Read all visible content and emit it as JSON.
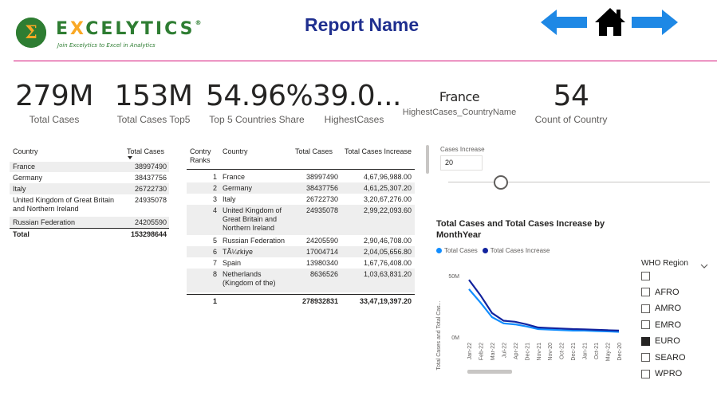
{
  "header": {
    "logo_pre": "E",
    "logo_x": "X",
    "logo_post": "CELYTICS",
    "logo_registered": "®",
    "logo_tagline": "Join Excelytics to Excel in Analytics",
    "report_name": "Report Name"
  },
  "kpis": [
    {
      "value": "279M",
      "label": "Total Cases"
    },
    {
      "value": "153M",
      "label": "Total Cases Top5"
    },
    {
      "value": "54.96%",
      "label": "Top 5 Countries Share"
    },
    {
      "value": "39.0...",
      "label": "HighestCases"
    },
    {
      "value": "France",
      "label": "HighestCases_CountryName"
    },
    {
      "value": "54",
      "label": "Count of Country"
    }
  ],
  "table_top5": {
    "headers": [
      "Country",
      "Total Cases"
    ],
    "rows": [
      {
        "country": "France",
        "cases": "38997490"
      },
      {
        "country": "Germany",
        "cases": "38437756"
      },
      {
        "country": "Italy",
        "cases": "26722730"
      },
      {
        "country": "United Kingdom of Great Britain and Northern Ireland",
        "cases": "24935078"
      },
      {
        "country": "Russian Federation",
        "cases": "24205590"
      }
    ],
    "total_label": "Total",
    "total_value": "153298644"
  },
  "table_ranks": {
    "headers": [
      "Contry Ranks",
      "Country",
      "Total Cases",
      "Total Cases Increase"
    ],
    "rows": [
      {
        "rank": "1",
        "country": "France",
        "cases": "38997490",
        "increase": "4,67,96,988.00"
      },
      {
        "rank": "2",
        "country": "Germany",
        "cases": "38437756",
        "increase": "4,61,25,307.20"
      },
      {
        "rank": "3",
        "country": "Italy",
        "cases": "26722730",
        "increase": "3,20,67,276.00"
      },
      {
        "rank": "4",
        "country": "United Kingdom of Great Britain and Northern Ireland",
        "cases": "24935078",
        "increase": "2,99,22,093.60"
      },
      {
        "rank": "5",
        "country": "Russian Federation",
        "cases": "24205590",
        "increase": "2,90,46,708.00"
      },
      {
        "rank": "6",
        "country": "TÃ¼rkiye",
        "cases": "17004714",
        "increase": "2,04,05,656.80"
      },
      {
        "rank": "7",
        "country": "Spain",
        "cases": "13980340",
        "increase": "1,67,76,408.00"
      },
      {
        "rank": "8",
        "country": "Netherlands (Kingdom of the)",
        "cases": "8636526",
        "increase": "1,03,63,831.20"
      }
    ],
    "total_rank": "1",
    "total_cases": "278932831",
    "total_increase": "33,47,19,397.20"
  },
  "slicer": {
    "title": "Cases Increase",
    "value": "20"
  },
  "chart": {
    "title": "Total Cases and Total Cases Increase by MonthYear",
    "legend": [
      "Total Cases",
      "Total Cases Increase"
    ],
    "colors": {
      "total_cases": "#118dff",
      "total_cases_increase": "#12239e"
    },
    "y_axis_label": "Total Cases and Total Cas...",
    "y_ticks": [
      "50M",
      "0M"
    ]
  },
  "chart_data": {
    "type": "line",
    "title": "Total Cases and Total Cases Increase by MonthYear",
    "x": [
      "Jan-22",
      "Feb-22",
      "Mar-22",
      "Jul-22",
      "Apr-22",
      "Dec-21",
      "Nov-21",
      "Nov-20",
      "Oct-22",
      "Dec-21",
      "Jan-21",
      "Oct-21",
      "May-22",
      "Dec-20"
    ],
    "ylabel": "Total Cases and Total Cas...",
    "ylim": [
      0,
      60000000
    ],
    "series": [
      {
        "name": "Total Cases",
        "values": [
          47000000,
          34000000,
          20000000,
          14000000,
          13000000,
          11000000,
          8500000,
          8000000,
          7500000,
          7000000,
          7000000,
          6500000,
          6200000,
          5800000
        ]
      },
      {
        "name": "Total Cases Increase",
        "values": [
          56000000,
          41000000,
          24000000,
          16500000,
          15500000,
          13000000,
          10000000,
          9500000,
          9000000,
          8500000,
          8200000,
          7800000,
          7400000,
          7000000
        ]
      }
    ]
  },
  "region_slicer": {
    "title": "WHO Region",
    "items": [
      {
        "label": "",
        "checked": false
      },
      {
        "label": "AFRO",
        "checked": false
      },
      {
        "label": "AMRO",
        "checked": false
      },
      {
        "label": "EMRO",
        "checked": false
      },
      {
        "label": "EURO",
        "checked": true
      },
      {
        "label": "SEARO",
        "checked": false
      },
      {
        "label": "WPRO",
        "checked": false
      }
    ]
  }
}
